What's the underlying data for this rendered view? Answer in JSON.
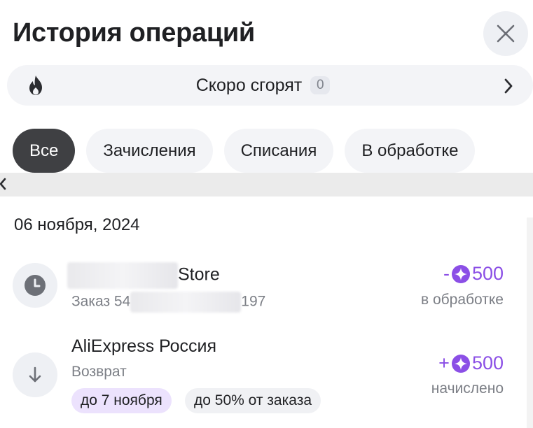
{
  "header": {
    "title": "История операций"
  },
  "burn": {
    "label": "Скоро сгорят",
    "count": "0"
  },
  "tabs": [
    {
      "label": "Все",
      "active": true
    },
    {
      "label": "Зачисления",
      "active": false
    },
    {
      "label": "Списания",
      "active": false
    },
    {
      "label": "В обработке",
      "active": false
    }
  ],
  "date_group": "06 ноября, 2024",
  "operations": [
    {
      "icon": "clock-icon",
      "title_suffix": "Store",
      "sub_prefix": "Заказ 54",
      "sub_suffix": "197",
      "sign": "-",
      "amount": "500",
      "status": "в обработке"
    },
    {
      "icon": "arrow-down-icon",
      "title": "AliExpress Россия",
      "sub": "Возврат",
      "sign": "+",
      "amount": "500",
      "status": "начислено",
      "chips": [
        "до 7 ноября",
        "до 50% от заказа"
      ]
    }
  ],
  "colors": {
    "accent": "#8b4fe6",
    "active_tab": "#3f4043",
    "chip_purple": "#ece2fd",
    "muted_text": "#7c7f86"
  }
}
